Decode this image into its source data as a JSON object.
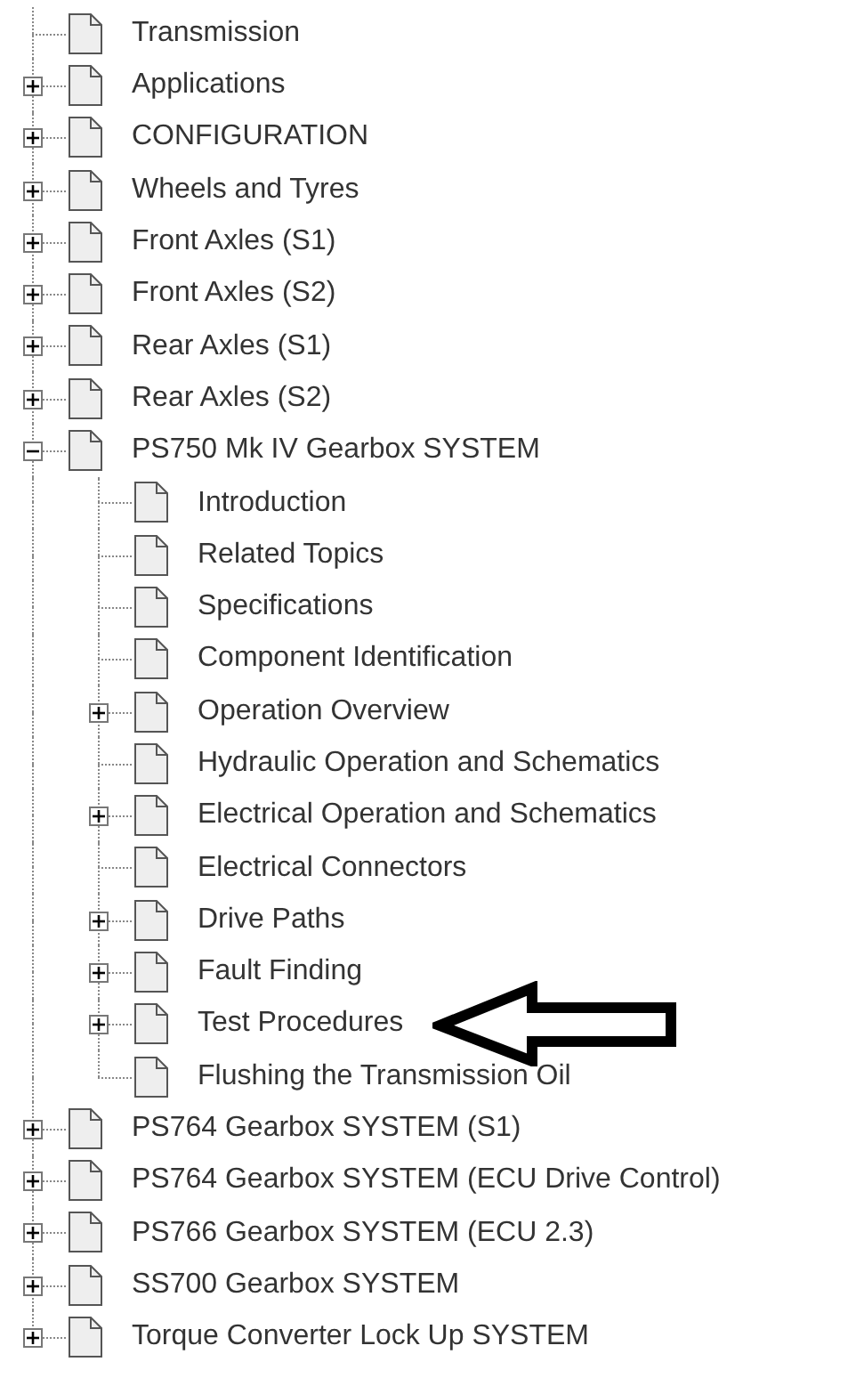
{
  "tree": [
    {
      "label": "Transmission",
      "expandable": false,
      "pointer": false
    },
    {
      "label": "Applications",
      "expandable": true,
      "expanded": false,
      "pointer": false
    },
    {
      "label": "CONFIGURATION",
      "expandable": true,
      "expanded": false,
      "pointer": false
    },
    {
      "label": "Wheels and Tyres",
      "expandable": true,
      "expanded": false,
      "pointer": false
    },
    {
      "label": "Front Axles (S1)",
      "expandable": true,
      "expanded": false,
      "pointer": false
    },
    {
      "label": "Front Axles (S2)",
      "expandable": true,
      "expanded": false,
      "pointer": false
    },
    {
      "label": "Rear Axles (S1)",
      "expandable": true,
      "expanded": false,
      "pointer": false
    },
    {
      "label": "Rear Axles (S2)",
      "expandable": true,
      "expanded": false,
      "pointer": false
    },
    {
      "label": "PS750 Mk IV Gearbox SYSTEM",
      "expandable": true,
      "expanded": true,
      "pointer": false,
      "children": [
        {
          "label": "Introduction",
          "expandable": false,
          "pointer": false
        },
        {
          "label": "Related Topics",
          "expandable": false,
          "pointer": false
        },
        {
          "label": "Specifications",
          "expandable": false,
          "pointer": false
        },
        {
          "label": "Component Identification",
          "expandable": false,
          "pointer": false
        },
        {
          "label": "Operation Overview",
          "expandable": true,
          "expanded": false,
          "pointer": false
        },
        {
          "label": "Hydraulic Operation and Schematics",
          "expandable": false,
          "pointer": false
        },
        {
          "label": "Electrical Operation and Schematics",
          "expandable": true,
          "expanded": false,
          "pointer": false
        },
        {
          "label": "Electrical Connectors",
          "expandable": false,
          "pointer": false
        },
        {
          "label": "Drive Paths",
          "expandable": true,
          "expanded": false,
          "pointer": false
        },
        {
          "label": "Fault Finding",
          "expandable": true,
          "expanded": false,
          "pointer": false
        },
        {
          "label": "Test Procedures",
          "expandable": true,
          "expanded": false,
          "pointer": true
        },
        {
          "label": "Flushing the Transmission Oil",
          "expandable": false,
          "pointer": false
        }
      ]
    },
    {
      "label": "PS764 Gearbox SYSTEM (S1)",
      "expandable": true,
      "expanded": false,
      "pointer": false
    },
    {
      "label": "PS764 Gearbox SYSTEM (ECU Drive Control)",
      "expandable": true,
      "expanded": false,
      "pointer": false
    },
    {
      "label": "PS766 Gearbox SYSTEM (ECU 2.3)",
      "expandable": true,
      "expanded": false,
      "pointer": false
    },
    {
      "label": "SS700 Gearbox SYSTEM",
      "expandable": true,
      "expanded": false,
      "pointer": false
    },
    {
      "label": "Torque Converter Lock Up SYSTEM",
      "expandable": true,
      "expanded": false,
      "pointer": false
    }
  ]
}
